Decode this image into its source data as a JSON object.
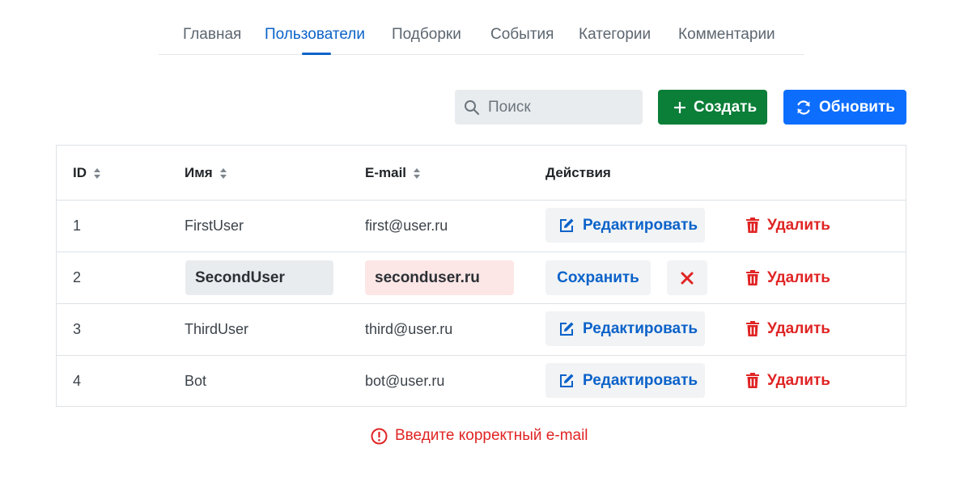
{
  "nav": {
    "tabs": [
      {
        "label": "Главная",
        "active": false
      },
      {
        "label": "Пользователи",
        "active": true
      },
      {
        "label": "Подборки",
        "active": false
      },
      {
        "label": "События",
        "active": false
      },
      {
        "label": "Категории",
        "active": false
      },
      {
        "label": "Комментарии",
        "active": false
      }
    ]
  },
  "toolbar": {
    "search_placeholder": "Поиск",
    "search_icon": "search-icon",
    "create_label": "Создать",
    "create_icon": "plus-icon",
    "refresh_label": "Обновить",
    "refresh_icon": "refresh-icon"
  },
  "table": {
    "headers": {
      "id": "ID",
      "name": "Имя",
      "email": "E-mail",
      "actions": "Действия"
    },
    "rows": [
      {
        "id": "1",
        "name": "FirstUser",
        "email": "first@user.ru",
        "mode": "view"
      },
      {
        "id": "2",
        "name": "SecondUser",
        "email": "seconduser.ru",
        "mode": "edit"
      },
      {
        "id": "3",
        "name": "ThirdUser",
        "email": "third@user.ru",
        "mode": "view"
      },
      {
        "id": "4",
        "name": "Bot",
        "email": "bot@user.ru",
        "mode": "view"
      }
    ],
    "edit_label": "Редактировать",
    "save_label": "Сохранить",
    "delete_label": "Удалить"
  },
  "error": {
    "message": "Введите корректный e-mail"
  },
  "colors": {
    "primary": "#0d6efd",
    "link": "#0b62c9",
    "success": "#0b7e38",
    "danger": "#e02424",
    "invalid_bg": "#fde6e6",
    "input_bg": "#e9ecef"
  }
}
